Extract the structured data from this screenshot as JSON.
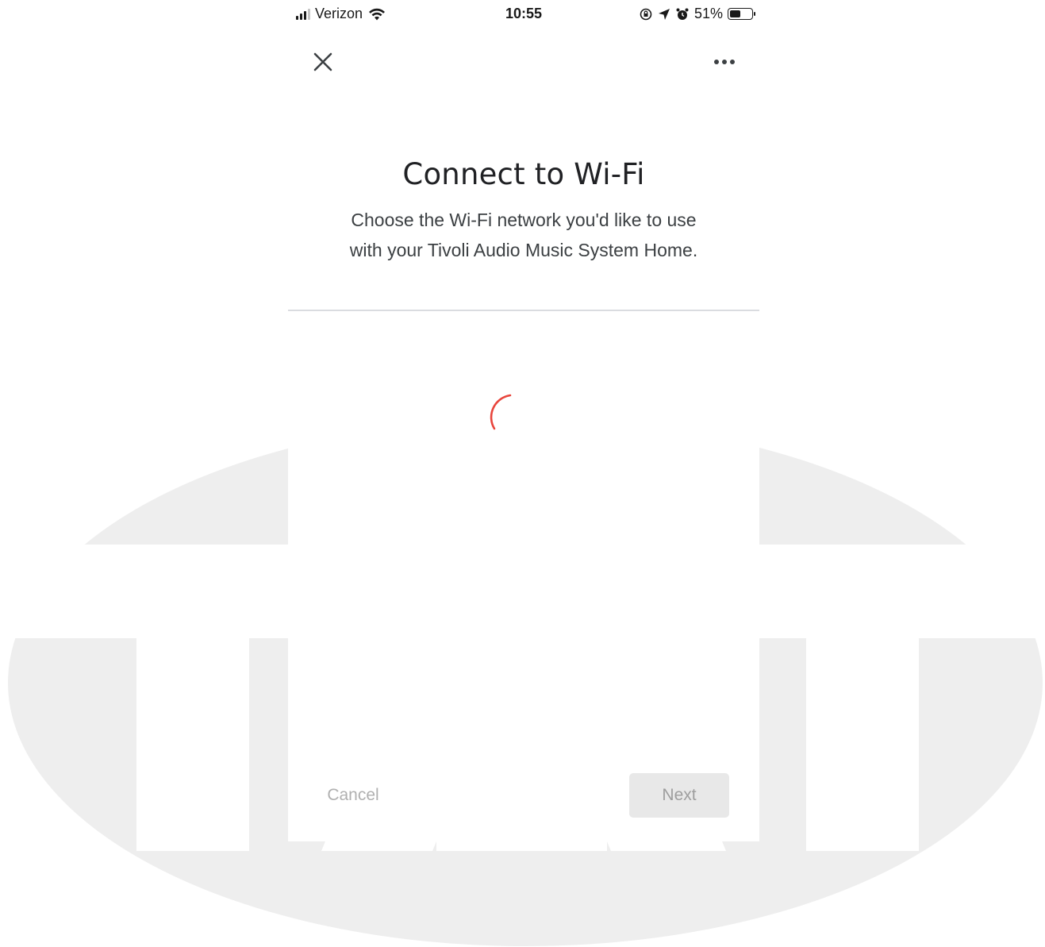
{
  "status_bar": {
    "carrier": "Verizon",
    "time": "10:55",
    "battery_percent_label": "51%",
    "battery_level": 0.51,
    "icons": [
      "signal-icon",
      "wifi-icon",
      "orientation-lock-icon",
      "location-icon",
      "alarm-icon",
      "battery-icon"
    ]
  },
  "app_bar": {
    "close_icon": "close-icon",
    "more_icon": "more-options-icon"
  },
  "main": {
    "title": "Connect to Wi-Fi",
    "subtitle_line1": "Choose the Wi-Fi network you'd like to use",
    "subtitle_line2": "with your Tivoli Audio Music System Home.",
    "loading": true,
    "spinner_color": "#e8453c"
  },
  "footer": {
    "cancel_label": "Cancel",
    "next_label": "Next",
    "next_enabled": false
  },
  "colors": {
    "background_shape": "#eeeeee",
    "text_primary": "#202124",
    "disabled_text": "#b0b0b0"
  }
}
